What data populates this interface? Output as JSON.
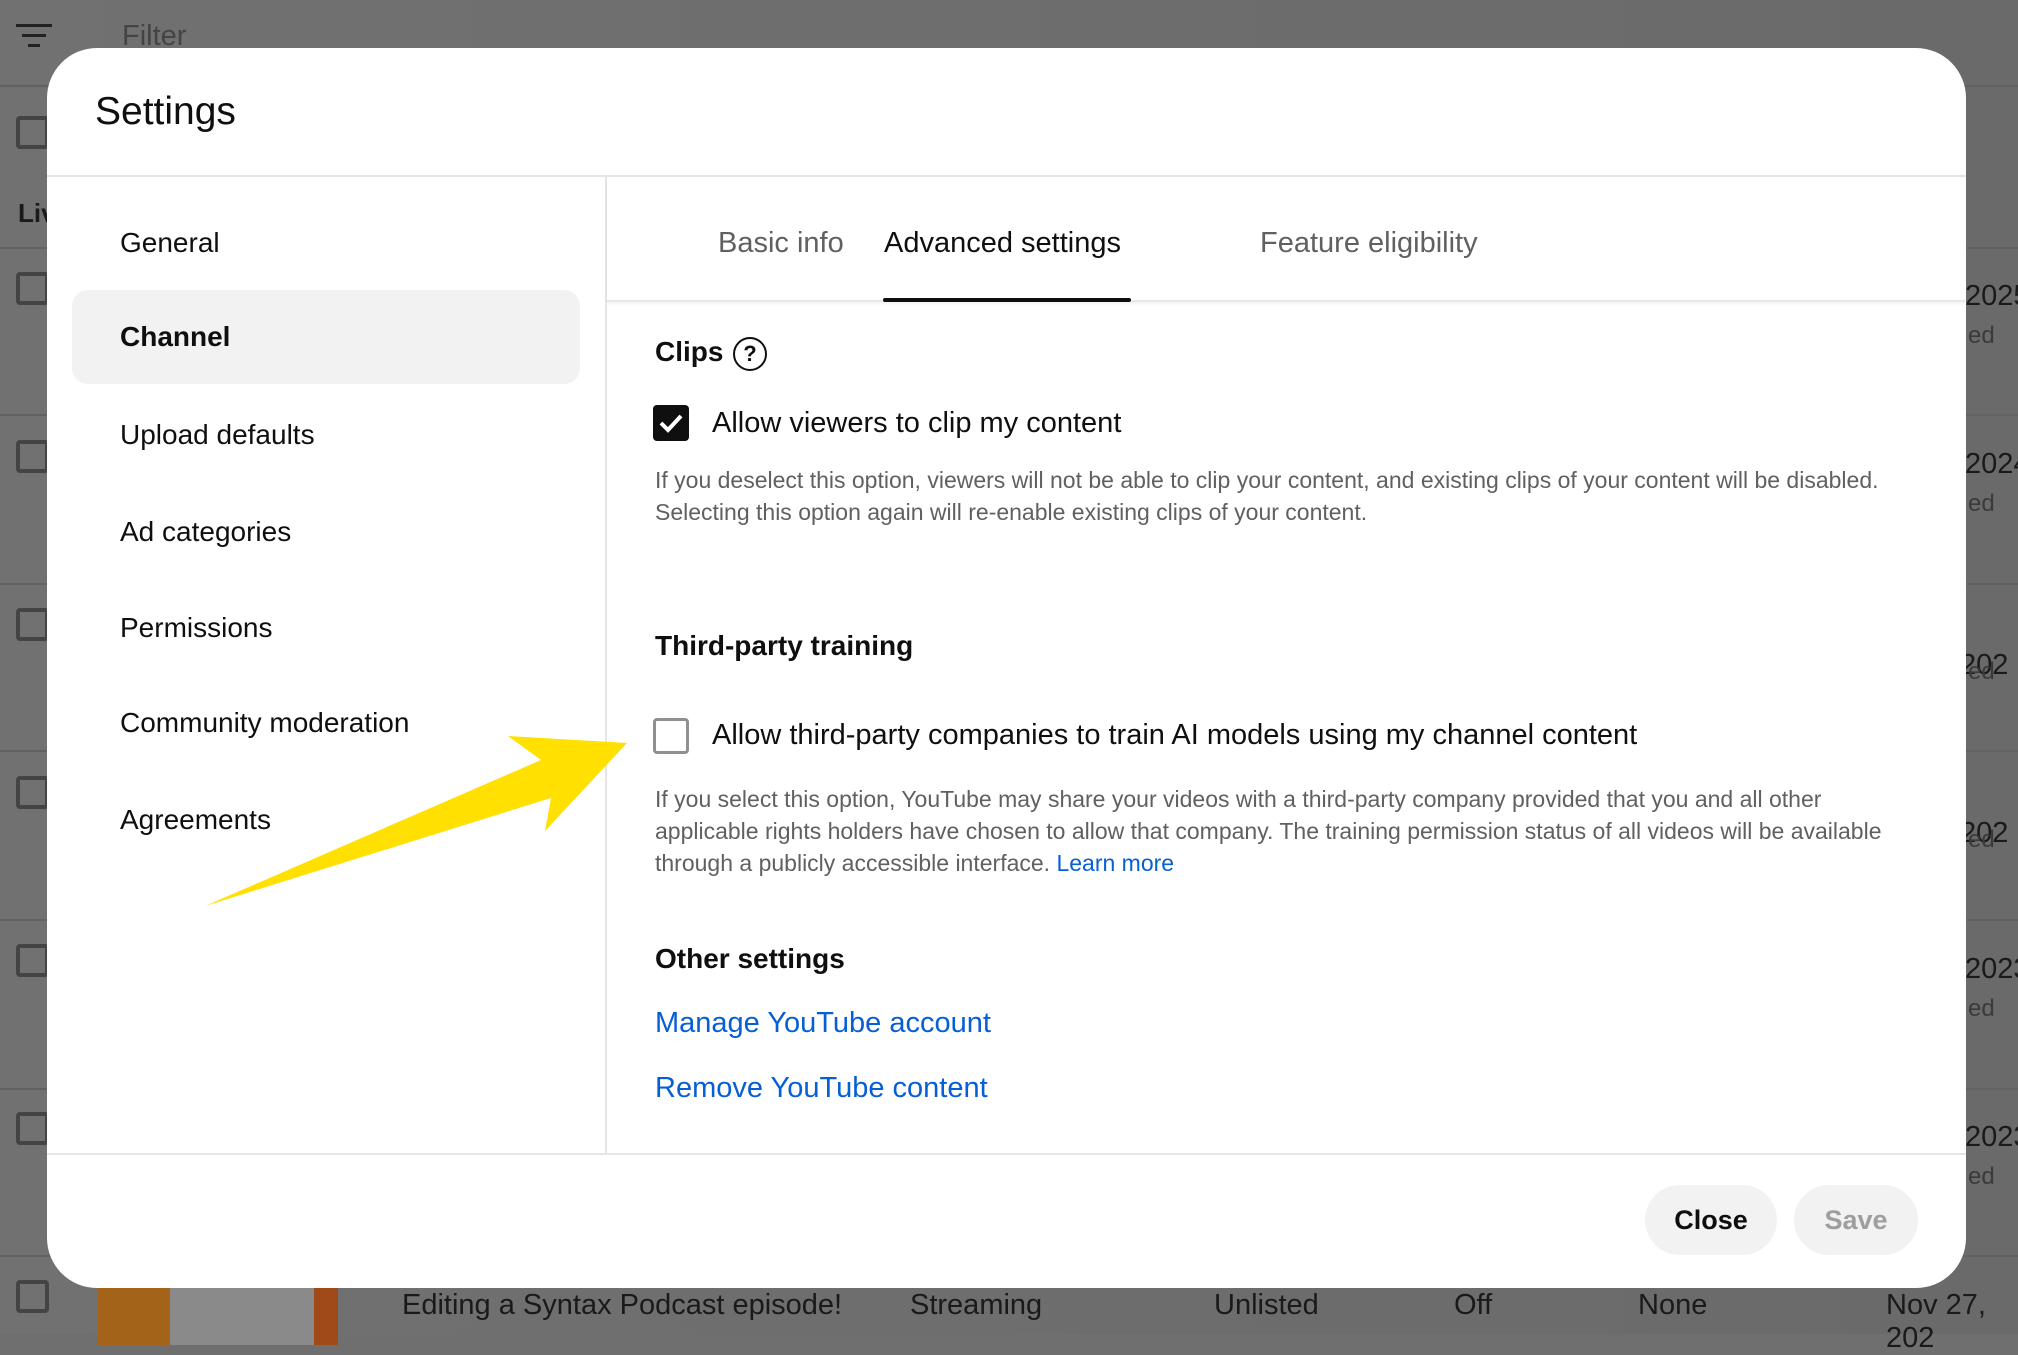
{
  "background": {
    "filter_placeholder": "Filter",
    "section_label": "Liv",
    "row_dates": [
      "2025",
      "2024",
      ", 202",
      ", 202",
      "2023",
      "2023"
    ],
    "row_status_fragment": "ed",
    "bottom_row": {
      "title": "Editing a Syntax Podcast episode!",
      "type": "Streaming",
      "visibility": "Unlisted",
      "monetization": "Off",
      "restrictions": "None",
      "date": "Nov 27, 202"
    }
  },
  "dialog": {
    "title": "Settings",
    "sidebar": {
      "items": [
        {
          "label": "General"
        },
        {
          "label": "Channel",
          "selected": true
        },
        {
          "label": "Upload defaults"
        },
        {
          "label": "Ad categories"
        },
        {
          "label": "Permissions"
        },
        {
          "label": "Community moderation"
        },
        {
          "label": "Agreements"
        }
      ]
    },
    "tabs": [
      {
        "label": "Basic info"
      },
      {
        "label": "Advanced settings",
        "active": true
      },
      {
        "label": "Feature eligibility"
      }
    ],
    "clips": {
      "heading": "Clips",
      "checkbox_label": "Allow viewers to clip my content",
      "checked": true,
      "description": "If you deselect this option, viewers will not be able to clip your content, and existing clips of your content will be disabled. Selecting this option again will re-enable existing clips of your content."
    },
    "training": {
      "heading": "Third-party training",
      "checkbox_label": "Allow third-party companies to train AI models using my channel content",
      "checked": false,
      "description": "If you select this option, YouTube may share your videos with a third-party company provided that you and all other applicable rights holders have chosen to allow that company. The training permission status of all videos will be available through a publicly accessible interface.",
      "learn_more": "Learn more"
    },
    "other": {
      "heading": "Other settings",
      "links": [
        "Manage YouTube account",
        "Remove YouTube content"
      ]
    },
    "footer": {
      "close": "Close",
      "save": "Save"
    }
  },
  "colors": {
    "accent_link": "#065fd4",
    "annotation_arrow": "#ffe000"
  }
}
